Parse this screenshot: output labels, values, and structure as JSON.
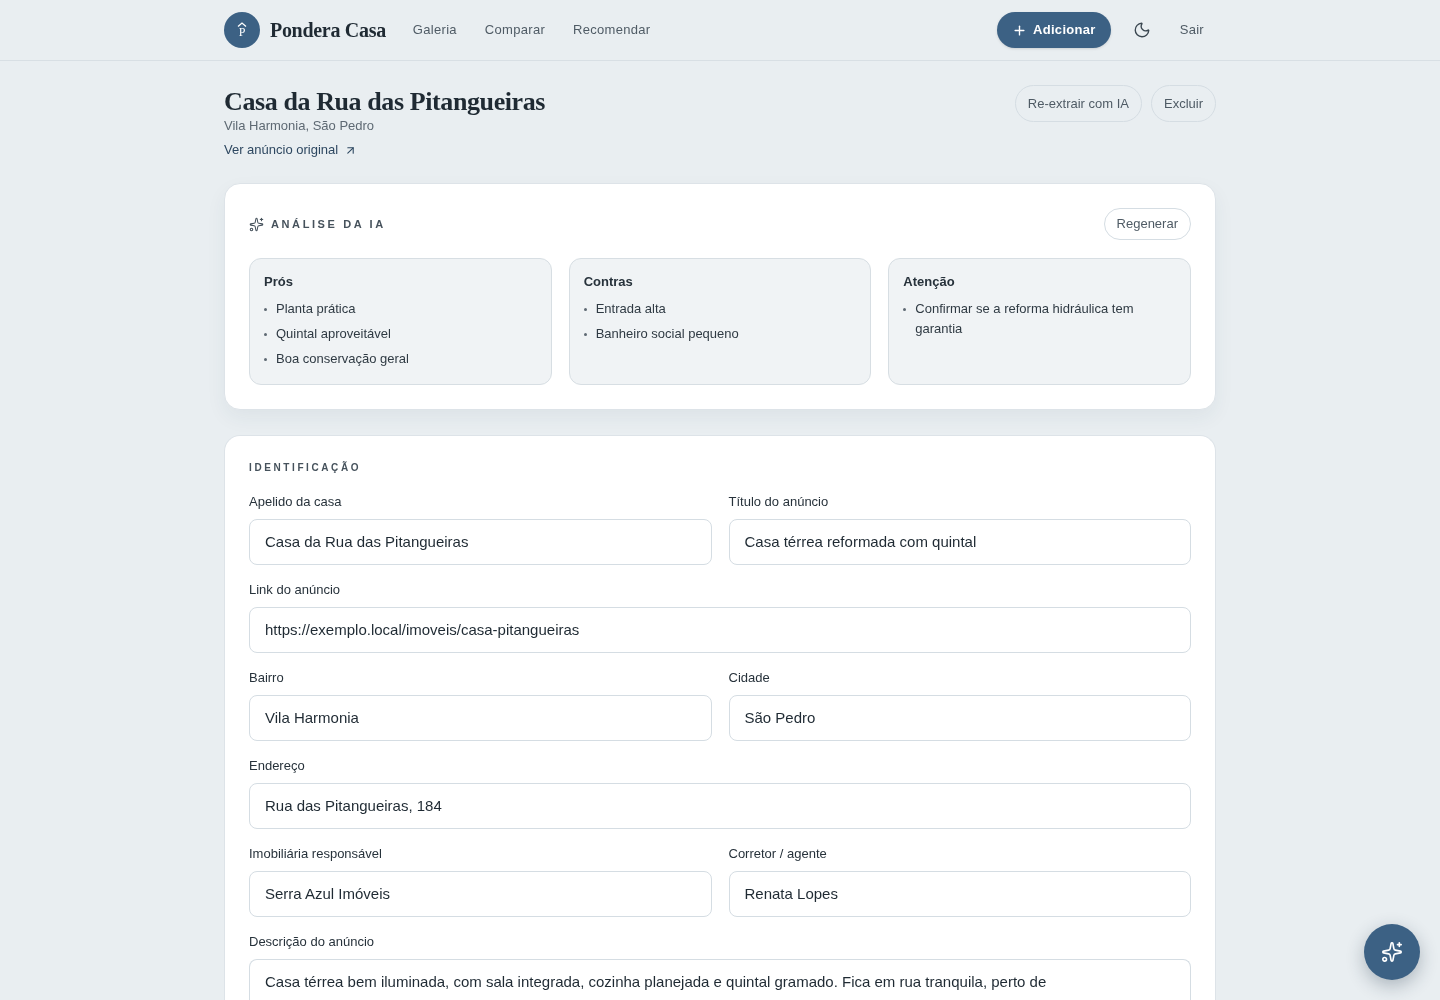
{
  "header": {
    "brand_letter": "P",
    "brand": "Pondera Casa",
    "nav": [
      "Galeria",
      "Comparar",
      "Recomendar"
    ],
    "add_button": "Adicionar",
    "logout": "Sair"
  },
  "page": {
    "title": "Casa da Rua das Pitangueiras",
    "subtitle": "Vila Harmonia, São Pedro",
    "link": "Ver anúncio original",
    "actions": [
      "Re-extrair com IA",
      "Excluir"
    ]
  },
  "ai_analysis": {
    "heading": "ANÁLISE DA IA",
    "regenerate": "Regenerar",
    "panels": [
      {
        "title": "Prós",
        "items": [
          "Planta prática",
          "Quintal aproveitável",
          "Boa conservação geral"
        ]
      },
      {
        "title": "Contras",
        "items": [
          "Entrada alta",
          "Banheiro social pequeno"
        ]
      },
      {
        "title": "Atenção",
        "items": [
          "Confirmar se a reforma hidráulica tem garantia"
        ]
      }
    ]
  },
  "identification": {
    "heading": "IDENTIFICAÇÃO",
    "rows": [
      [
        {
          "kind": "input",
          "label": "Apelido da casa",
          "value": "Casa da Rua das Pitangueiras"
        },
        {
          "kind": "input",
          "label": "Título do anúncio",
          "value": "Casa térrea reformada com quintal"
        }
      ],
      [
        {
          "kind": "input",
          "label": "Link do anúncio",
          "value": "https://exemplo.local/imoveis/casa-pitangueiras"
        }
      ],
      [
        {
          "kind": "input",
          "label": "Bairro",
          "value": "Vila Harmonia"
        },
        {
          "kind": "input",
          "label": "Cidade",
          "value": "São Pedro"
        }
      ],
      [
        {
          "kind": "input",
          "label": "Endereço",
          "value": "Rua das Pitangueiras, 184"
        }
      ],
      [
        {
          "kind": "input",
          "label": "Imobiliária responsável",
          "value": "Serra Azul Imóveis"
        },
        {
          "kind": "input",
          "label": "Corretor / agente",
          "value": "Renata Lopes"
        }
      ],
      [
        {
          "kind": "textarea",
          "label": "Descrição do anúncio",
          "value": "Casa térrea bem iluminada, com sala integrada, cozinha planejada e quintal gramado. Fica em rua tranquila, perto de"
        }
      ]
    ]
  }
}
